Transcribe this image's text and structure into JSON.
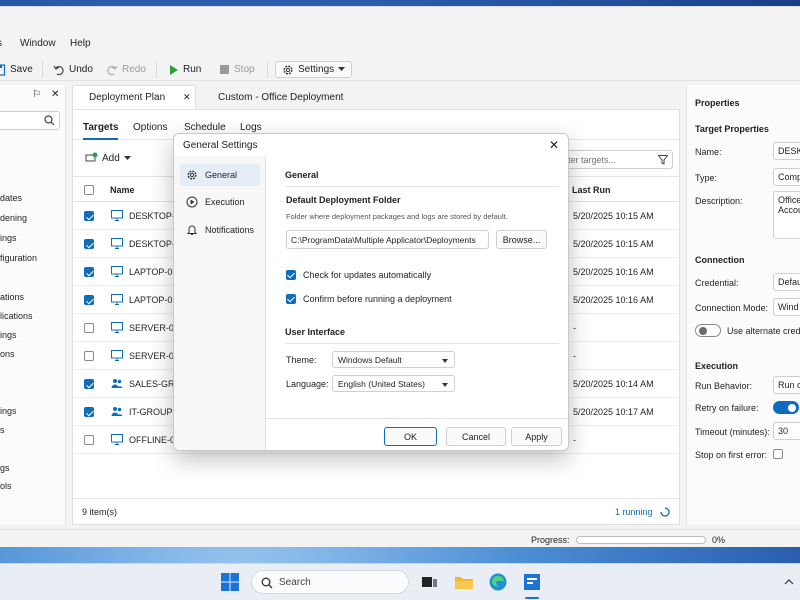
{
  "menu": {
    "window": "Window",
    "help": "Help"
  },
  "toolbar": {
    "save": "Save",
    "undo": "Undo",
    "redo": "Redo",
    "run": "Run",
    "stop": "Stop",
    "settings": "Settings"
  },
  "left_pane": {
    "pin": "⚐",
    "close": "✕",
    "items": [
      "dates",
      "dening",
      "ings",
      "figuration",
      "ations",
      "lications",
      "ings",
      "ons",
      "ings",
      "s",
      "gs",
      "ols"
    ]
  },
  "doc_tabs": {
    "active": "Deployment Plan",
    "other": "Custom - Office Deployment",
    "close": "✕"
  },
  "sub_tabs": [
    "Targets",
    "Options",
    "Schedule",
    "Logs"
  ],
  "add_label": "Add",
  "filter_placeholder": "lter targets...",
  "grid": {
    "col_name": "Name",
    "col_last_run": "Last Run",
    "rows": [
      {
        "checked": true,
        "icon": "monitor-icon",
        "name": "DESKTOP-0",
        "last_run": "5/20/2025 10:15 AM"
      },
      {
        "checked": true,
        "icon": "monitor-icon",
        "name": "DESKTOP-0",
        "last_run": "5/20/2025 10:15 AM"
      },
      {
        "checked": true,
        "icon": "monitor-icon",
        "name": "LAPTOP-01",
        "last_run": "5/20/2025 10:16 AM"
      },
      {
        "checked": true,
        "icon": "monitor-icon",
        "name": "LAPTOP-02",
        "last_run": "5/20/2025 10:16 AM"
      },
      {
        "checked": false,
        "icon": "monitor-icon",
        "name": "SERVER-01",
        "last_run": "-"
      },
      {
        "checked": false,
        "icon": "monitor-icon",
        "name": "SERVER-02",
        "last_run": "-"
      },
      {
        "checked": true,
        "icon": "group-icon",
        "name": "SALES-GRO",
        "last_run": "5/20/2025 10:14 AM"
      },
      {
        "checked": true,
        "icon": "group-icon",
        "name": "IT-GROUP",
        "last_run": "5/20/2025 10:17 AM"
      },
      {
        "checked": false,
        "icon": "monitor-icon",
        "name": "OFFLINE-0",
        "last_run": "-"
      }
    ],
    "item_count": "9 item(s)",
    "running": "1 running"
  },
  "properties": {
    "title": "Properties",
    "target_section": "Target Properties",
    "name_label": "Name:",
    "name_value": "DESK",
    "type_label": "Type:",
    "type_value": "Comp",
    "desc_label": "Description:",
    "desc_value_1": "Office",
    "desc_value_2": "Accou",
    "connection_section": "Connection",
    "credential_label": "Credential:",
    "credential_value": "Defau",
    "conn_mode_label": "Connection Mode:",
    "conn_mode_value": "Wind",
    "alt_cred_label": "Use alternate crede",
    "execution_section": "Execution",
    "run_behavior_label": "Run Behavior:",
    "run_behavior_value": "Run o",
    "retry_label": "Retry on failure:",
    "timeout_label": "Timeout (minutes):",
    "timeout_value": "30",
    "stop_error_label": "Stop on first error:"
  },
  "status": {
    "progress_label": "Progress:",
    "progress_value": "0%",
    "progress_fraction": 0
  },
  "dialog": {
    "title": "General Settings",
    "nav": [
      "General",
      "Execution",
      "Notifications"
    ],
    "section_general": "General",
    "folder_heading": "Default Deployment Folder",
    "folder_desc": "Folder where deployment packages and logs are stored by default.",
    "folder_value": "C:\\ProgramData\\Multiple Applicator\\Deployments",
    "browse": "Browse...",
    "check_updates": "Check for updates automatically",
    "confirm_run": "Confirm before running a deployment",
    "section_ui": "User Interface",
    "theme_label": "Theme:",
    "theme_value": "Windows Default",
    "language_label": "Language:",
    "language_value": "English (United States)",
    "ok": "OK",
    "cancel": "Cancel",
    "apply": "Apply"
  },
  "taskbar": {
    "search": "Search"
  },
  "colors": {
    "accent": "#0f6cbd",
    "run_green": "#2e9e44"
  }
}
